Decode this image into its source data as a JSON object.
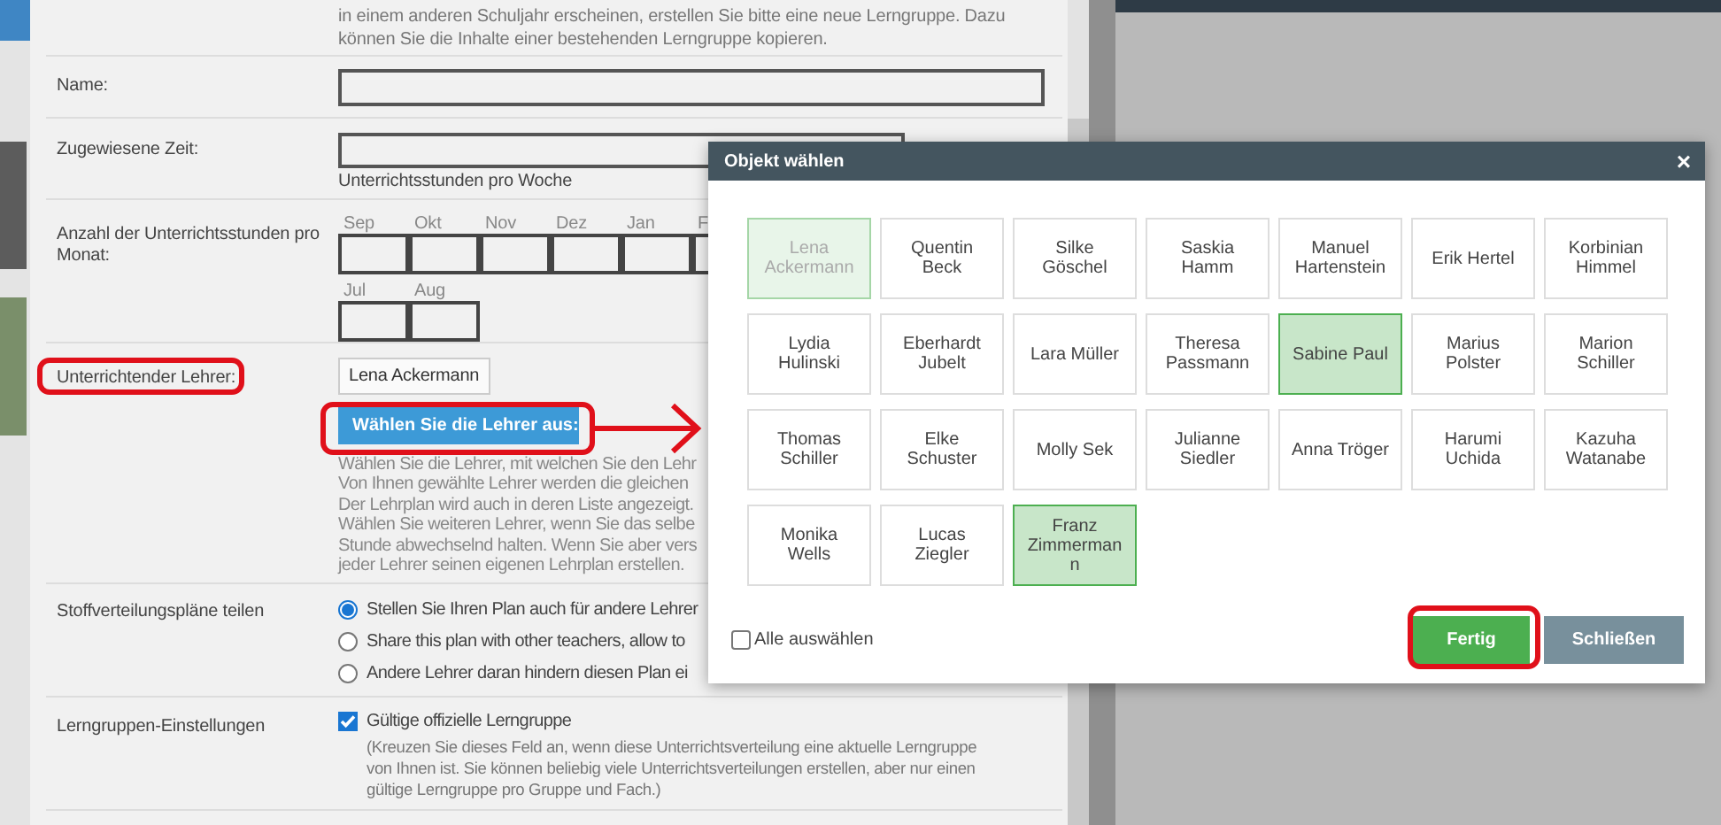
{
  "intro": [
    "in einem anderen Schuljahr erscheinen, erstellen Sie bitte eine neue Lerngruppe. Dazu",
    "können Sie die Inhalte einer bestehenden Lerngruppe kopieren."
  ],
  "rows": [
    {
      "kind": "text",
      "label": "Name:"
    },
    {
      "kind": "hours",
      "label": "Zugewiesene Zeit:",
      "hint": "Unterrichtsstunden pro Woche"
    },
    {
      "kind": "months",
      "label": "Anzahl der Unterrichtsstunden pro Monat:",
      "months": [
        [
          "Sep",
          "Okt",
          "Nov",
          "Dez",
          "Jan",
          "F"
        ],
        [
          "Jul",
          "Aug"
        ]
      ]
    },
    {
      "kind": "teachers",
      "label": "Unterrichtender Lehrer:",
      "teachers": [
        "Lena Ackermann"
      ],
      "button": "Wählen Sie die Lehrer aus:",
      "help": [
        "Wählen Sie die Lehrer, mit welchen Sie den Lehr",
        "Von Ihnen gewählte Lehrer werden die gleichen",
        "Der Lehrplan wird auch in deren Liste angezeigt.",
        "Wählen Sie weiteren Lehrer, wenn Sie das selbe",
        "Stunde abwechselnd halten. Wenn Sie aber vers",
        "jeder Lehrer seinen eigenen Lehrplan erstellen."
      ]
    },
    {
      "kind": "radios",
      "label": "Stoffverteilungspläne teilen",
      "options": [
        {
          "label": "Stellen Sie Ihren Plan auch für andere Lehrer",
          "selected": true
        },
        {
          "label": "Share this plan with other teachers, allow to",
          "selected": false
        },
        {
          "label": "Andere Lehrer daran hindern diesen Plan ei",
          "selected": false
        }
      ]
    },
    {
      "kind": "checkbox",
      "label": "Lerngruppen-Einstellungen",
      "option": "Gültige offizielle Lerngruppe",
      "checked": true,
      "note": [
        "(Kreuzen Sie dieses Feld an, wenn diese Unterrichtsverteilung eine aktuelle Lerngruppe",
        "von Ihnen ist. Sie können beliebig viele Unterrichtsverteilungen erstellen, aber nur einen",
        "gültige Lerngruppe pro Gruppe und Fach.)"
      ]
    }
  ],
  "dialog": {
    "title": "Objekt wählen",
    "close": "×",
    "tiles": [
      {
        "name": "Lena Ackermann",
        "selected": false,
        "disabled": true
      },
      {
        "name": "Quentin Beck",
        "selected": false,
        "disabled": false
      },
      {
        "name": "Silke Göschel",
        "selected": false,
        "disabled": false
      },
      {
        "name": "Saskia Hamm",
        "selected": false,
        "disabled": false
      },
      {
        "name": "Manuel Hartenstein",
        "selected": false,
        "disabled": false
      },
      {
        "name": "Erik Hertel",
        "selected": false,
        "disabled": false
      },
      {
        "name": "Korbinian Himmel",
        "selected": false,
        "disabled": false
      },
      {
        "name": "Lydia Hulinski",
        "selected": false,
        "disabled": false
      },
      {
        "name": "Eberhardt Jubelt",
        "selected": false,
        "disabled": false
      },
      {
        "name": "Lara Müller",
        "selected": false,
        "disabled": false
      },
      {
        "name": "Theresa Passmann",
        "selected": false,
        "disabled": false
      },
      {
        "name": "Sabine Paul",
        "selected": true,
        "disabled": false
      },
      {
        "name": "Marius Polster",
        "selected": false,
        "disabled": false
      },
      {
        "name": "Marion Schiller",
        "selected": false,
        "disabled": false
      },
      {
        "name": "Thomas Schiller",
        "selected": false,
        "disabled": false
      },
      {
        "name": "Elke Schuster",
        "selected": false,
        "disabled": false
      },
      {
        "name": "Molly Sek",
        "selected": false,
        "disabled": false
      },
      {
        "name": "Julianne Siedler",
        "selected": false,
        "disabled": false
      },
      {
        "name": "Anna Tröger",
        "selected": false,
        "disabled": false
      },
      {
        "name": "Harumi Uchida",
        "selected": false,
        "disabled": false
      },
      {
        "name": "Kazuha Watanabe",
        "selected": false,
        "disabled": false
      },
      {
        "name": "Monika Wells",
        "selected": false,
        "disabled": false
      },
      {
        "name": "Lucas Ziegler",
        "selected": false,
        "disabled": false
      },
      {
        "name": "Franz Zimmermann",
        "selected": true,
        "disabled": false
      }
    ],
    "select_all": {
      "label": "Alle auswählen",
      "checked": false
    },
    "buttons": [
      {
        "kind": "primary",
        "label": "Fertig"
      },
      {
        "kind": "secondary",
        "label": "Schließen"
      }
    ]
  }
}
